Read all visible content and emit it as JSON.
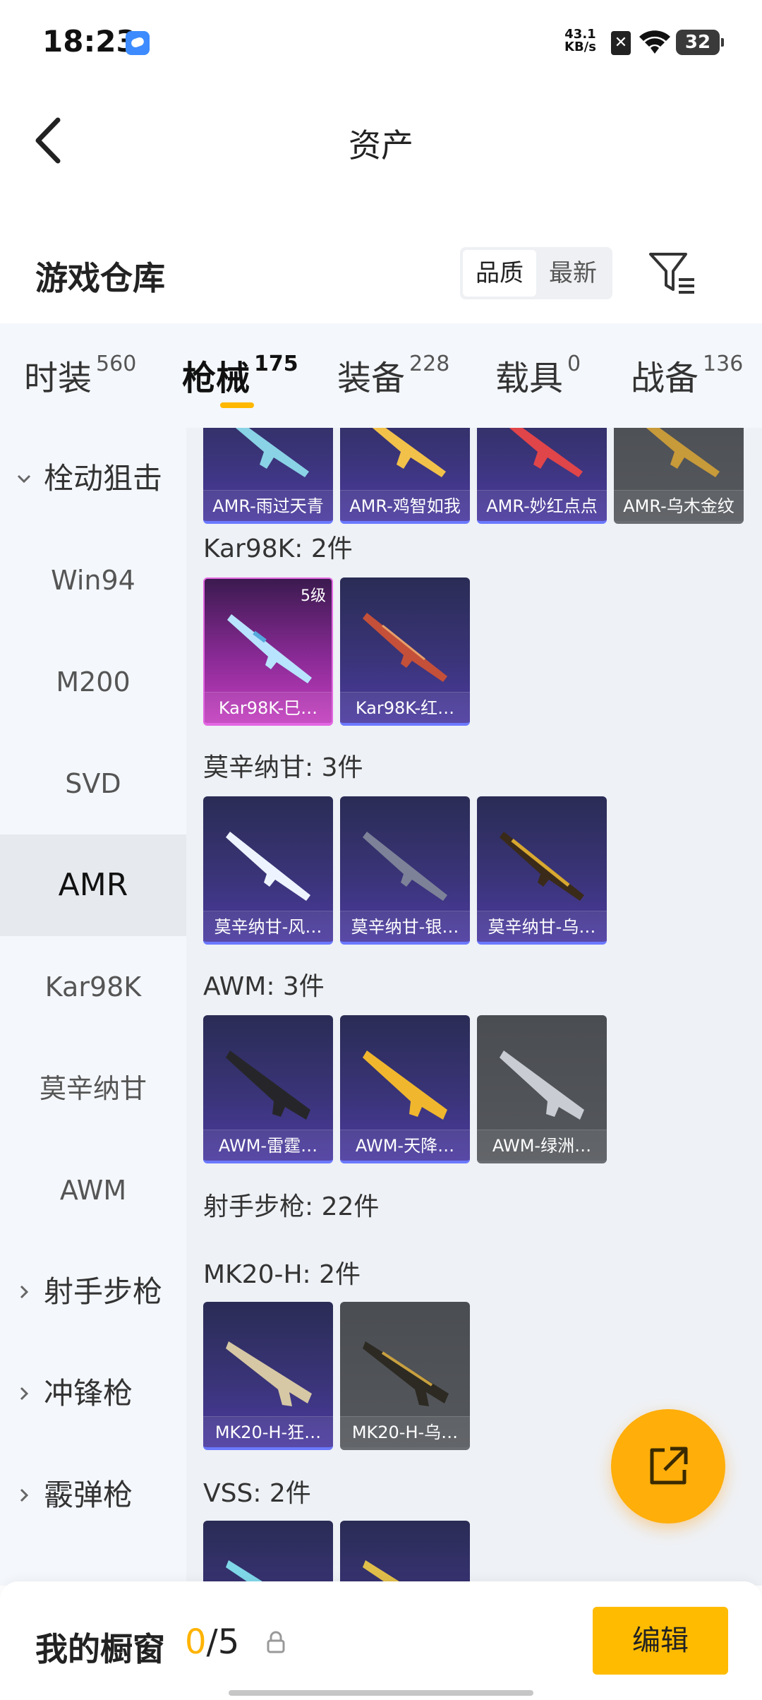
{
  "status_bar": {
    "time": "18:23",
    "net_speed_value": "43.1",
    "net_speed_unit": "KB/s",
    "battery": "32"
  },
  "header": {
    "title": "资产"
  },
  "warehouse": {
    "title": "游戏仓库",
    "sort_options": [
      "品质",
      "最新"
    ],
    "active_sort": "品质"
  },
  "tabs": [
    {
      "label": "时装",
      "count": "560"
    },
    {
      "label": "枪械",
      "count": "175"
    },
    {
      "label": "装备",
      "count": "228"
    },
    {
      "label": "载具",
      "count": "0"
    },
    {
      "label": "战备",
      "count": "136"
    }
  ],
  "active_tab": "枪械",
  "sidebar": {
    "items": [
      {
        "label": "栓动狙击",
        "type": "group",
        "expanded": true
      },
      {
        "label": "Win94",
        "type": "sub"
      },
      {
        "label": "M200",
        "type": "sub"
      },
      {
        "label": "SVD",
        "type": "sub"
      },
      {
        "label": "AMR",
        "type": "sub",
        "active": true
      },
      {
        "label": "Kar98K",
        "type": "sub"
      },
      {
        "label": "莫辛纳甘",
        "type": "sub"
      },
      {
        "label": "AWM",
        "type": "sub"
      },
      {
        "label": "射手步枪",
        "type": "group",
        "expanded": false
      },
      {
        "label": "冲锋枪",
        "type": "group",
        "expanded": false
      },
      {
        "label": "霰弹枪",
        "type": "group",
        "expanded": false
      }
    ]
  },
  "content": {
    "amr_row": [
      "AMR-雨过天青",
      "AMR-鸡智如我",
      "AMR-妙红点点",
      "AMR-乌木金纹"
    ],
    "sections": [
      {
        "label": "Kar98K: 2件",
        "items": [
          {
            "name": "Kar98K-巳…",
            "level": "5级"
          },
          {
            "name": "Kar98K-红…"
          }
        ]
      },
      {
        "label": "莫辛纳甘: 3件",
        "items": [
          {
            "name": "莫辛纳甘-风…"
          },
          {
            "name": "莫辛纳甘-银…"
          },
          {
            "name": "莫辛纳甘-乌…"
          }
        ]
      },
      {
        "label": "AWM: 3件",
        "items": [
          {
            "name": "AWM-雷霆…"
          },
          {
            "name": "AWM-天降…"
          },
          {
            "name": "AWM-绿洲…"
          }
        ]
      },
      {
        "label": "射手步枪: 22件"
      },
      {
        "label": "MK20-H: 2件",
        "items": [
          {
            "name": "MK20-H-狂…"
          },
          {
            "name": "MK20-H-乌…"
          }
        ]
      },
      {
        "label": "VSS: 2件"
      }
    ]
  },
  "bottom_bar": {
    "title": "我的橱窗",
    "count_current": "0",
    "count_total": "/5",
    "edit_label": "编辑"
  },
  "colors": {
    "accent": "#ffb800",
    "card_purple": "#3a3478",
    "card_pink": "#c43fbf",
    "card_gray": "#55585d"
  }
}
